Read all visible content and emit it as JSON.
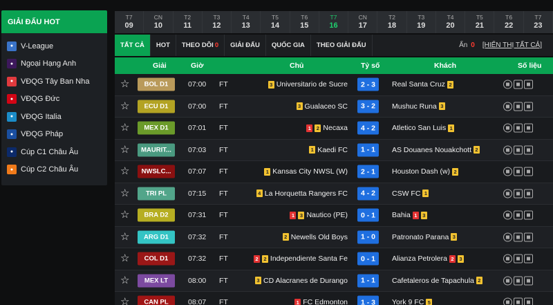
{
  "sidebar": {
    "title": "GIẢI ĐẤU HOT",
    "items": [
      {
        "label": "V-League",
        "icon": "vleague-logo",
        "color": "#3a73c8"
      },
      {
        "label": "Ngoại Hạng Anh",
        "icon": "premier-league-logo",
        "color": "#3d185c"
      },
      {
        "label": "VĐQG Tây Ban Nha",
        "icon": "laliga-logo",
        "color": "#e03a3e"
      },
      {
        "label": "VĐQG Đức",
        "icon": "bundesliga-logo",
        "color": "#d20515"
      },
      {
        "label": "VĐQG Italia",
        "icon": "serie-a-logo",
        "color": "#1b8cc8"
      },
      {
        "label": "VĐQG Pháp",
        "icon": "ligue1-logo",
        "color": "#1a4fa0"
      },
      {
        "label": "Cúp C1 Châu Âu",
        "icon": "champions-league-logo",
        "color": "#0c2a6a"
      },
      {
        "label": "Cúp C2 Châu Âu",
        "icon": "europa-league-logo",
        "color": "#f07a1a"
      }
    ]
  },
  "dates": [
    {
      "day": "T7",
      "num": "09",
      "active": false
    },
    {
      "day": "CN",
      "num": "10",
      "active": false
    },
    {
      "day": "T2",
      "num": "11",
      "active": false
    },
    {
      "day": "T3",
      "num": "12",
      "active": false
    },
    {
      "day": "T4",
      "num": "13",
      "active": false
    },
    {
      "day": "T5",
      "num": "14",
      "active": false
    },
    {
      "day": "T6",
      "num": "15",
      "active": false
    },
    {
      "day": "T7",
      "num": "16",
      "active": true
    },
    {
      "day": "CN",
      "num": "17",
      "active": false
    },
    {
      "day": "T2",
      "num": "18",
      "active": false
    },
    {
      "day": "T3",
      "num": "19",
      "active": false
    },
    {
      "day": "T4",
      "num": "20",
      "active": false
    },
    {
      "day": "T5",
      "num": "21",
      "active": false
    },
    {
      "day": "T6",
      "num": "22",
      "active": false
    },
    {
      "day": "T7",
      "num": "23",
      "active": false
    }
  ],
  "tabs": {
    "all": "TẤT CẢ",
    "hot": "HOT",
    "following": "THEO DÕI",
    "following_count": "0",
    "league": "GIẢI ĐẤU",
    "country": "QUỐC GIA",
    "by_league": "THEO GIẢI ĐẤU"
  },
  "hidden": {
    "label": "Ẩn",
    "count": "0",
    "show_all": "[HIỂN THỊ TẤT CẢ]"
  },
  "columns": {
    "league": "Giải",
    "time": "Giờ",
    "home": "Chủ",
    "score": "Tỷ số",
    "away": "Khách",
    "stats": "Số liệu"
  },
  "matches": [
    {
      "league": "BOL D1",
      "league_color": "#b99a5a",
      "time": "07:00",
      "status": "FT",
      "home": "Universitario de Sucre",
      "home_cards": [
        {
          "t": "y",
          "n": "3"
        }
      ],
      "home_cards_before": true,
      "score": "2 - 3",
      "away": "Real Santa Cruz",
      "away_cards": [
        {
          "t": "y",
          "n": "2"
        }
      ]
    },
    {
      "league": "ECU D1",
      "league_color": "#b3a323",
      "time": "07:00",
      "status": "FT",
      "home": "Gualaceo SC",
      "home_cards": [
        {
          "t": "y",
          "n": "3"
        }
      ],
      "score": "3 - 2",
      "away": "Mushuc Runa",
      "away_cards": [
        {
          "t": "y",
          "n": "3"
        }
      ]
    },
    {
      "league": "MEX D1",
      "league_color": "#6b9b2a",
      "time": "07:01",
      "status": "FT",
      "home": "Necaxa",
      "home_cards": [
        {
          "t": "r",
          "n": "1"
        },
        {
          "t": "y",
          "n": "2"
        }
      ],
      "score": "4 - 2",
      "away": "Atletico San Luis",
      "away_cards": [
        {
          "t": "y",
          "n": "1"
        }
      ]
    },
    {
      "league": "MAURIT...",
      "league_color": "#4a9a80",
      "time": "07:03",
      "status": "FT",
      "home": "Kaedi FC",
      "home_cards": [
        {
          "t": "y",
          "n": "1"
        }
      ],
      "score": "1 - 1",
      "away": "AS Douanes Nouakchott",
      "away_cards": [
        {
          "t": "y",
          "n": "2"
        }
      ]
    },
    {
      "league": "NWSLC...",
      "league_color": "#8a1010",
      "time": "07:07",
      "status": "FT",
      "home": "Kansas City NWSL (W)",
      "home_cards": [
        {
          "t": "y",
          "n": "1"
        }
      ],
      "score": "2 - 1",
      "away": "Houston Dash (w)",
      "away_cards": [
        {
          "t": "y",
          "n": "2"
        }
      ]
    },
    {
      "league": "TRI PL",
      "league_color": "#52a58a",
      "time": "07:15",
      "status": "FT",
      "home": "La Horquetta Rangers FC",
      "home_cards": [
        {
          "t": "y",
          "n": "4"
        }
      ],
      "score": "4 - 2",
      "away": "CSW FC",
      "away_cards": [
        {
          "t": "y",
          "n": "1"
        }
      ]
    },
    {
      "league": "BRA D2",
      "league_color": "#b6ae22",
      "time": "07:31",
      "status": "FT",
      "home": "Nautico (PE)",
      "home_cards": [
        {
          "t": "r",
          "n": "1"
        },
        {
          "t": "y",
          "n": "3"
        }
      ],
      "score": "0 - 1",
      "away": "Bahia",
      "away_cards": [
        {
          "t": "r",
          "n": "1"
        },
        {
          "t": "y",
          "n": "3"
        }
      ]
    },
    {
      "league": "ARG D1",
      "league_color": "#34c4c4",
      "time": "07:32",
      "status": "FT",
      "home": "Newells Old Boys",
      "home_cards": [
        {
          "t": "y",
          "n": "2"
        }
      ],
      "score": "1 - 0",
      "away": "Patronato Parana",
      "away_cards": [
        {
          "t": "y",
          "n": "3"
        }
      ]
    },
    {
      "league": "COL D1",
      "league_color": "#9a1717",
      "time": "07:32",
      "status": "FT",
      "home": "Independiente Santa Fe",
      "home_cards": [
        {
          "t": "r",
          "n": "2"
        },
        {
          "t": "y",
          "n": "2"
        }
      ],
      "score": "0 - 1",
      "away": "Alianza Petrolera",
      "away_cards": [
        {
          "t": "r",
          "n": "2"
        },
        {
          "t": "y",
          "n": "3"
        }
      ]
    },
    {
      "league": "MEX LT",
      "league_color": "#7c4aa0",
      "time": "08:00",
      "status": "FT",
      "home": "CD Alacranes de Durango",
      "home_cards": [
        {
          "t": "y",
          "n": "3"
        }
      ],
      "score": "1 - 1",
      "away": "Cafetaleros de Tapachula",
      "away_cards": [
        {
          "t": "y",
          "n": "2"
        }
      ]
    },
    {
      "league": "CAN PL",
      "league_color": "#a01515",
      "time": "08:07",
      "status": "FT",
      "home": "FC Edmonton",
      "home_cards": [
        {
          "t": "r",
          "n": "1"
        }
      ],
      "score": "1 - 3",
      "away": "York 9 FC",
      "away_cards": [
        {
          "t": "y",
          "n": "5"
        }
      ]
    }
  ]
}
